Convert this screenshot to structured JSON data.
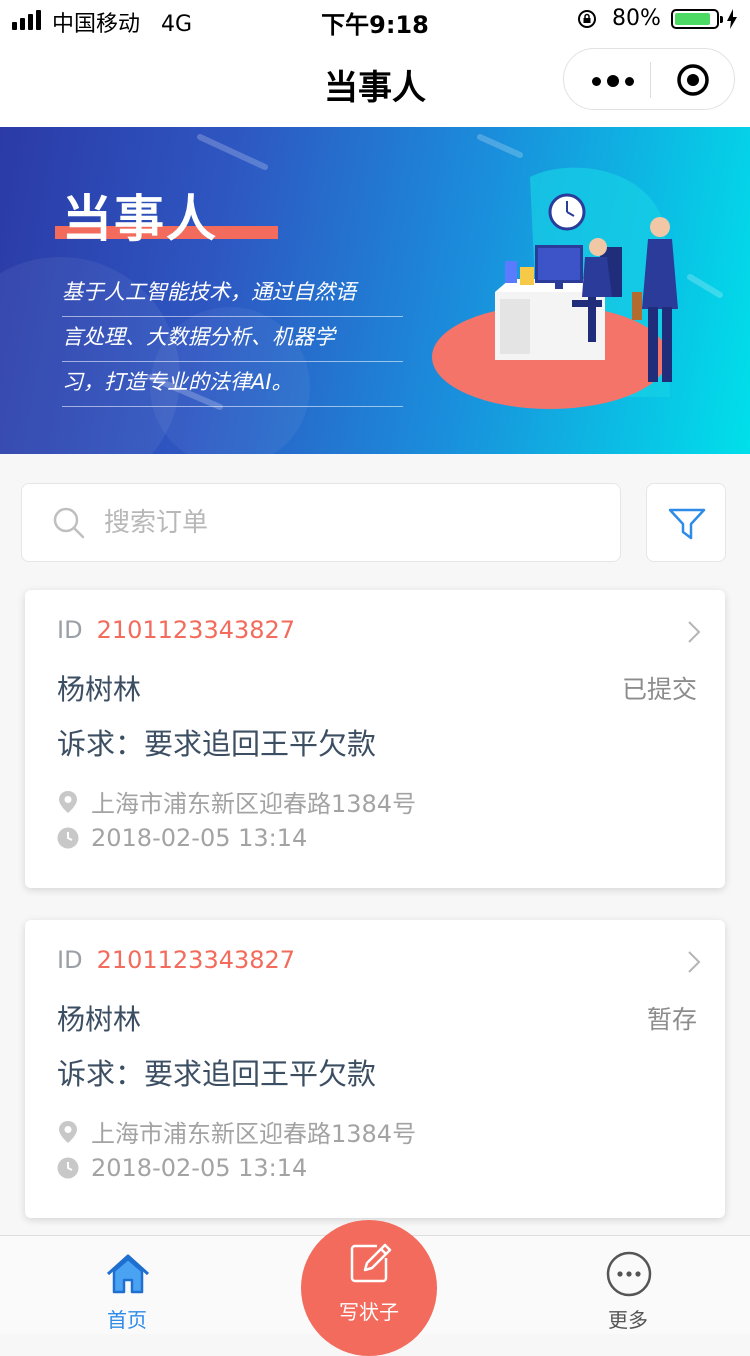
{
  "status_bar": {
    "carrier": "中国移动",
    "network": "4G",
    "time": "下午9:18",
    "battery": "80%"
  },
  "nav": {
    "title": "当事人"
  },
  "banner": {
    "title": "当事人",
    "description_lines": [
      "基于人工智能技术，通过自然语",
      "言处理、大数据分析、机器学",
      "习，打造专业的法律AI。"
    ]
  },
  "search": {
    "placeholder": "搜索订单"
  },
  "orders": [
    {
      "id_label": "ID",
      "id": "2101123343827",
      "name": "杨树林",
      "status": "已提交",
      "claim": "诉求：要求追回王平欠款",
      "address": "上海市浦东新区迎春路1384号",
      "time": "2018-02-05   13:14"
    },
    {
      "id_label": "ID",
      "id": "2101123343827",
      "name": "杨树林",
      "status": "暂存",
      "claim": "诉求：要求追回王平欠款",
      "address": "上海市浦东新区迎春路1384号",
      "time": "2018-02-05   13:14"
    }
  ],
  "tabs": {
    "home": "首页",
    "write": "写状子",
    "more": "更多"
  },
  "colors": {
    "accent": "#f26b5c",
    "primary_blue": "#2e8be8",
    "banner_start": "#2b3aa6",
    "banner_end": "#00e0ea"
  },
  "icons": [
    "signal-icon",
    "lock-rotation-icon",
    "battery-icon",
    "charging-icon",
    "more-dots-icon",
    "target-icon",
    "search-icon",
    "filter-icon",
    "chevron-right-icon",
    "location-pin-icon",
    "clock-icon",
    "home-icon",
    "pen-icon",
    "more-circle-icon"
  ]
}
